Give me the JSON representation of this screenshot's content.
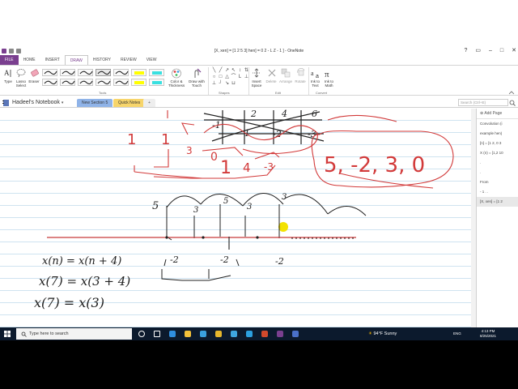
{
  "window": {
    "title": "[X, xen] = [1 2 5 3] hen] = 0 2 - L Z - 1 ] - OneNote"
  },
  "tabs": [
    "FILE",
    "HOME",
    "INSERT",
    "DRAW",
    "HISTORY",
    "REVIEW",
    "VIEW"
  ],
  "active_tab": "DRAW",
  "ribbon": {
    "type_label": "Type",
    "lasso_label": "Lasso Select",
    "eraser_label": "Eraser",
    "color_thickness_label": "Color & Thickness",
    "draw_touch_label": "Draw with Touch",
    "tools_group": "Tools",
    "shapes_group": "Shapes",
    "insert_space_label": "Insert Space",
    "delete_label": "Delete",
    "arrange_label": "Arrange",
    "rotate_label": "Rotate",
    "edit_group": "Edit",
    "ink_to_text_label": "Ink to Text",
    "ink_to_math_label": "Ink to Math",
    "convert_group": "Convert",
    "pen_colors": [
      "#222222",
      "#222222",
      "#222222",
      "#222222",
      "#222222",
      "#ffff00",
      "#39e0e0",
      "#222222",
      "#222222",
      "#222222",
      "#222222",
      "#222222",
      "#ffff00",
      "#39e0e0"
    ]
  },
  "notebook": {
    "name": "Hadeel's Notebook",
    "sections": [
      {
        "label": "New Section 5",
        "color": "#8fb3e8"
      },
      {
        "label": "Quick Notes",
        "color": "#f7d56b"
      }
    ],
    "add_section": "+",
    "search_placeholder": "Search (Ctrl+E)"
  },
  "page_pane": {
    "add_page": "Add Page",
    "pages": [
      "Convolution (i",
      "example hen)",
      "[n] = [1 2, 0 3",
      "X (n) = [1,2 10",
      ".",
      ".",
      "From",
      "- 1 . .",
      "[X, xen] = [1 2"
    ],
    "selected_index": 8
  },
  "ink": {
    "red_top_numbers": [
      "1",
      "1",
      "3",
      "0",
      "1",
      "4",
      "-3"
    ],
    "black_top_boxes": [
      "2",
      "4",
      "6",
      "-1",
      "-1",
      "-2",
      "-3"
    ],
    "boxed_sequence": "5, -2, 3, 0",
    "plot_left_label": "5",
    "plot_values": [
      "3",
      "5",
      "3",
      "3"
    ],
    "axis_labels": [
      "-2",
      "-2",
      "-2"
    ],
    "equations": [
      "x(n) = x(n + 4)",
      "x(7) = x(3 + 4)",
      "x(7) = x(3)"
    ],
    "colors": {
      "red": "#d23a3a",
      "black": "#202020",
      "highlight": "#f3e200"
    }
  },
  "taskbar": {
    "search_placeholder": "Type here to search",
    "weather": "94°F  Sunny",
    "language": "ENG",
    "time": "4:13 PM",
    "date": "8/25/2021",
    "apps": [
      {
        "name": "cortana",
        "color": "#ffffff"
      },
      {
        "name": "task-view",
        "color": "#ffffff"
      },
      {
        "name": "edge",
        "color": "#2f8fe0"
      },
      {
        "name": "file-explorer",
        "color": "#f3c13a"
      },
      {
        "name": "telegram",
        "color": "#3aa1e0"
      },
      {
        "name": "chrome",
        "color": "#e5b62d"
      },
      {
        "name": "app-5",
        "color": "#3fa7e0"
      },
      {
        "name": "app-6",
        "color": "#2ca0e0"
      },
      {
        "name": "powerpoint",
        "color": "#d1492c"
      },
      {
        "name": "onenote",
        "color": "#7a3f8f"
      },
      {
        "name": "app-9",
        "color": "#4a70c8"
      }
    ]
  }
}
